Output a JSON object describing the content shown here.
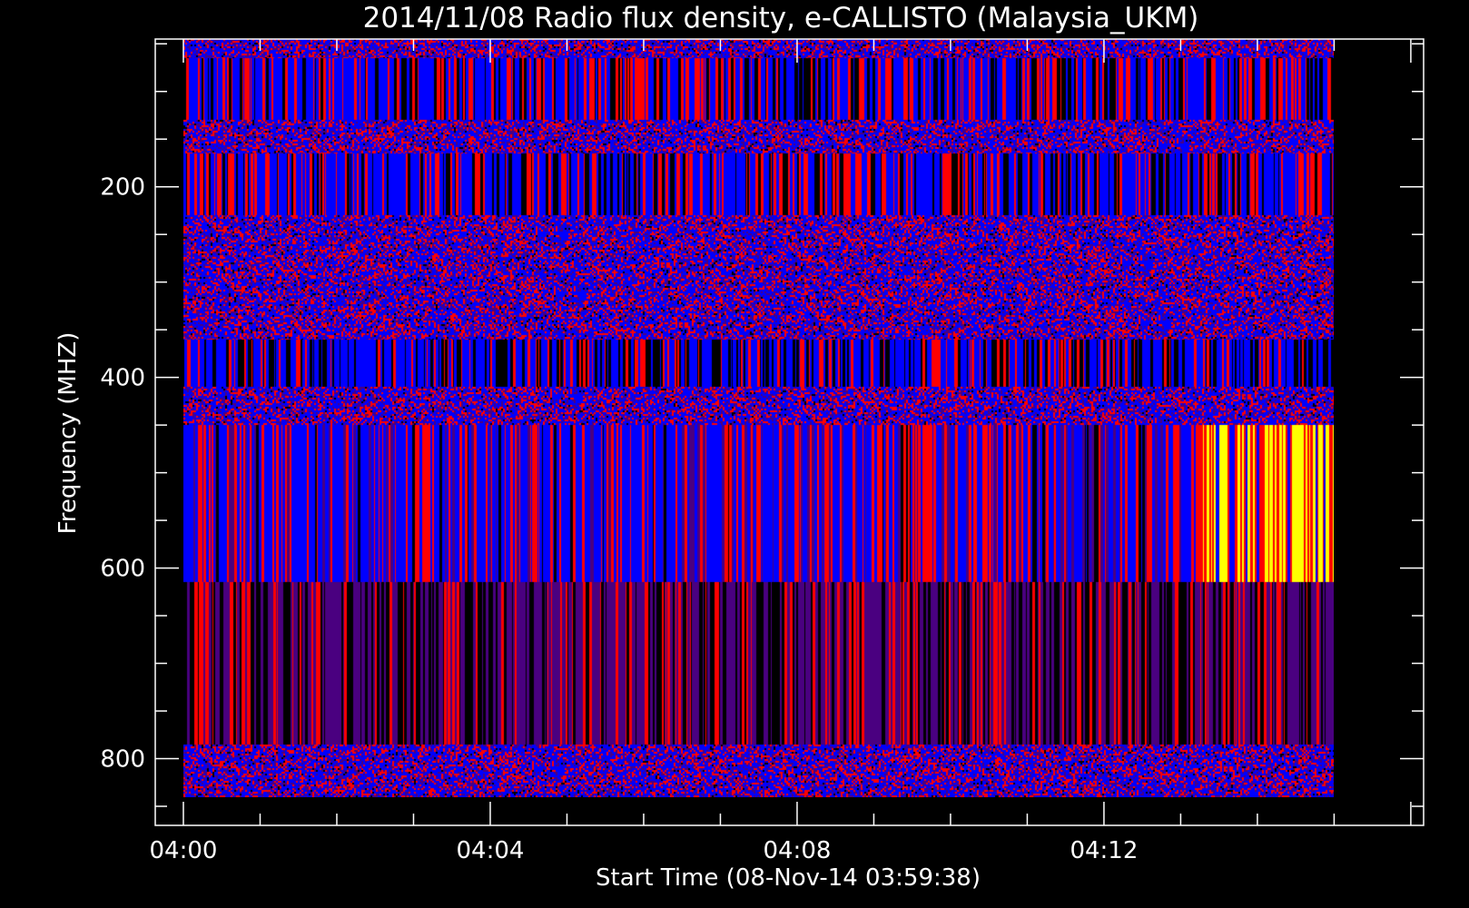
{
  "chart_data": {
    "type": "heatmap",
    "title": "2014/11/08  Radio flux density, e-CALLISTO (Malaysia_UKM)",
    "xlabel": "Start Time (08-Nov-14 03:59:38)",
    "ylabel": "Frequency (MHZ)",
    "x_range": [
      "03:59:38",
      "04:16:10"
    ],
    "data_x_range": [
      "04:00:00",
      "04:15:00"
    ],
    "y_range": [
      45,
      870
    ],
    "y_inverted": true,
    "x_ticks": [
      "04:00",
      "04:04",
      "04:08",
      "04:12"
    ],
    "y_ticks": [
      200,
      400,
      600,
      800
    ],
    "colormap": [
      "#000000",
      "#4a0080",
      "#0000ff",
      "#ff0000",
      "#ffff00"
    ],
    "bands": [
      {
        "from_mhz": 45,
        "to_mhz": 65,
        "pattern": "speckle",
        "dominant": [
          "#0000ff",
          "#ff0000",
          "#4a0080"
        ]
      },
      {
        "from_mhz": 65,
        "to_mhz": 130,
        "pattern": "vertical-stripes",
        "dominant": [
          "#0000ff",
          "#ff0000",
          "#000000"
        ]
      },
      {
        "from_mhz": 130,
        "to_mhz": 165,
        "pattern": "speckle",
        "dominant": [
          "#0000ff",
          "#ff0000",
          "#4a0080"
        ]
      },
      {
        "from_mhz": 165,
        "to_mhz": 230,
        "pattern": "vertical-stripes",
        "dominant": [
          "#0000ff",
          "#ff0000",
          "#000000"
        ]
      },
      {
        "from_mhz": 230,
        "to_mhz": 360,
        "pattern": "speckle",
        "dominant": [
          "#0000ff",
          "#ff0000",
          "#4a0080"
        ]
      },
      {
        "from_mhz": 360,
        "to_mhz": 410,
        "pattern": "vertical-stripes",
        "dominant": [
          "#0000ff",
          "#000000",
          "#ff0000"
        ]
      },
      {
        "from_mhz": 410,
        "to_mhz": 450,
        "pattern": "speckle",
        "dominant": [
          "#0000ff",
          "#ff0000",
          "#4a0080"
        ]
      },
      {
        "from_mhz": 450,
        "to_mhz": 615,
        "pattern": "vertical-stripes",
        "dominant": [
          "#0000ff",
          "#ff0000",
          "#4a0080"
        ]
      },
      {
        "from_mhz": 615,
        "to_mhz": 785,
        "pattern": "vertical-stripes",
        "dominant": [
          "#4a0080",
          "#000000",
          "#ff0000"
        ]
      },
      {
        "from_mhz": 785,
        "to_mhz": 840,
        "pattern": "speckle",
        "dominant": [
          "#0000ff",
          "#ff0000",
          "#4a0080"
        ]
      }
    ],
    "burst": {
      "from_time": "04:13:10",
      "to_time": "04:15:00",
      "from_mhz": 450,
      "to_mhz": 615,
      "colors": [
        "#ffff00",
        "#ff0000"
      ]
    },
    "grid": false
  }
}
